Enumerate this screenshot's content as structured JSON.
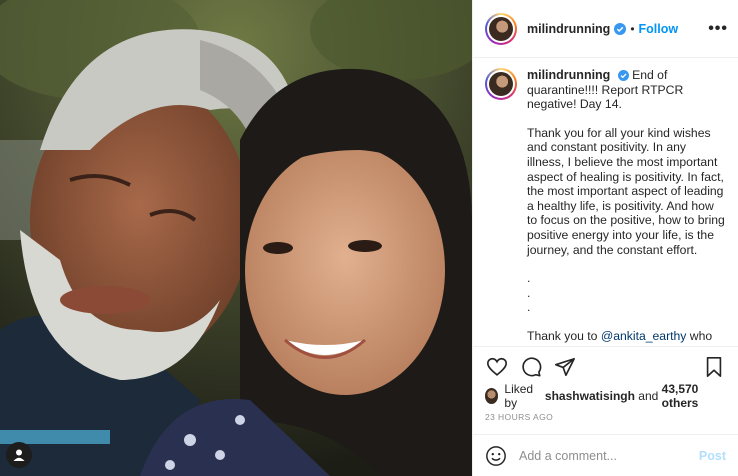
{
  "post": {
    "username": "milindrunning",
    "follow_label": "Follow",
    "more_label": "•••",
    "caption": {
      "username": "milindrunning",
      "lines": [
        "End of quarantine!!!! Report RTPCR negative! Day 14.",
        "Thank you for all your kind wishes and constant positivity. In any illness, I believe the most important aspect of healing is positivity. In fact, the most important aspect of leading a healthy life, is positivity. And how to focus on the positive, how to bring positive energy into your life, is the journey, and the constant effort.",
        ".",
        ".",
        "."
      ],
      "thanks_prefix": "Thank you to ",
      "mention": "@ankita_earthy",
      "thanks_suffix": " who traveled all the way back from Guwahati as soon as she heard, even though I told her not to 🙏 and took care of me like no one else..."
    },
    "likes": {
      "prefix": "Liked by ",
      "user": "shashwatisingh",
      "middle": " and ",
      "count": "43,570 others"
    },
    "timestamp": "23 HOURS AGO",
    "comment_placeholder": "Add a comment...",
    "post_label": "Post"
  },
  "icons": {
    "verified": "verified-badge-icon",
    "like": "heart-icon",
    "comment": "comment-icon",
    "share": "paper-plane-icon",
    "save": "bookmark-icon",
    "emoji": "smiley-icon",
    "tag": "user-tag-icon"
  },
  "colors": {
    "link": "#0095f6",
    "mention": "#00376b",
    "muted": "#8e8e8e",
    "post_disabled": "#b2dffc"
  }
}
